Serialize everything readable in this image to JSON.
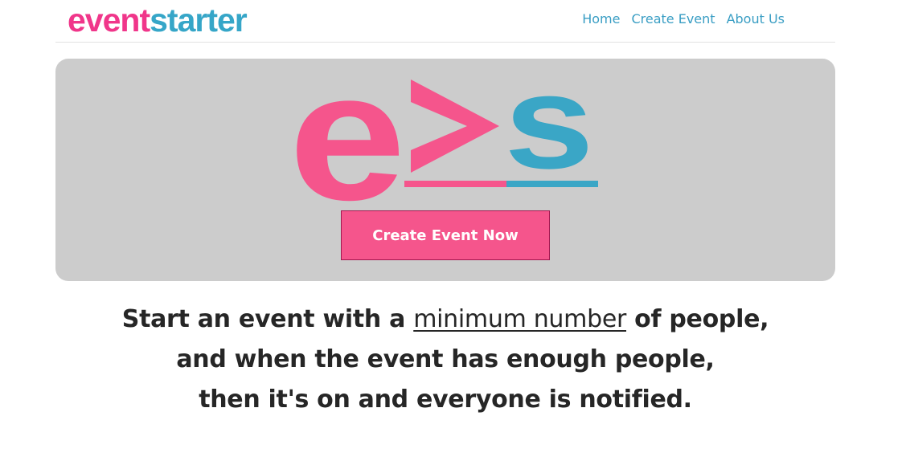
{
  "header": {
    "brand_part1": "event",
    "brand_part2": "starter",
    "nav": [
      {
        "label": "Home"
      },
      {
        "label": "Create Event"
      },
      {
        "label": "About Us"
      }
    ]
  },
  "hero": {
    "logo": {
      "letter_left": "e",
      "symbol": "≥",
      "letter_right": "s"
    },
    "cta_label": "Create Event Now"
  },
  "tagline": {
    "line1_before": "Start an event with a",
    "line1_emphasis": "minimum number",
    "line1_after": "of people,",
    "line2": "and when the event has enough people,",
    "line3": "then it's on and everyone is notified."
  },
  "colors": {
    "brand_pink": "#f0368a",
    "brand_blue": "#36a6c8",
    "logo_pink": "#f5558c",
    "logo_blue": "#3aa6c6",
    "hero_bg": "#cccccc",
    "text_dark": "#262626"
  }
}
